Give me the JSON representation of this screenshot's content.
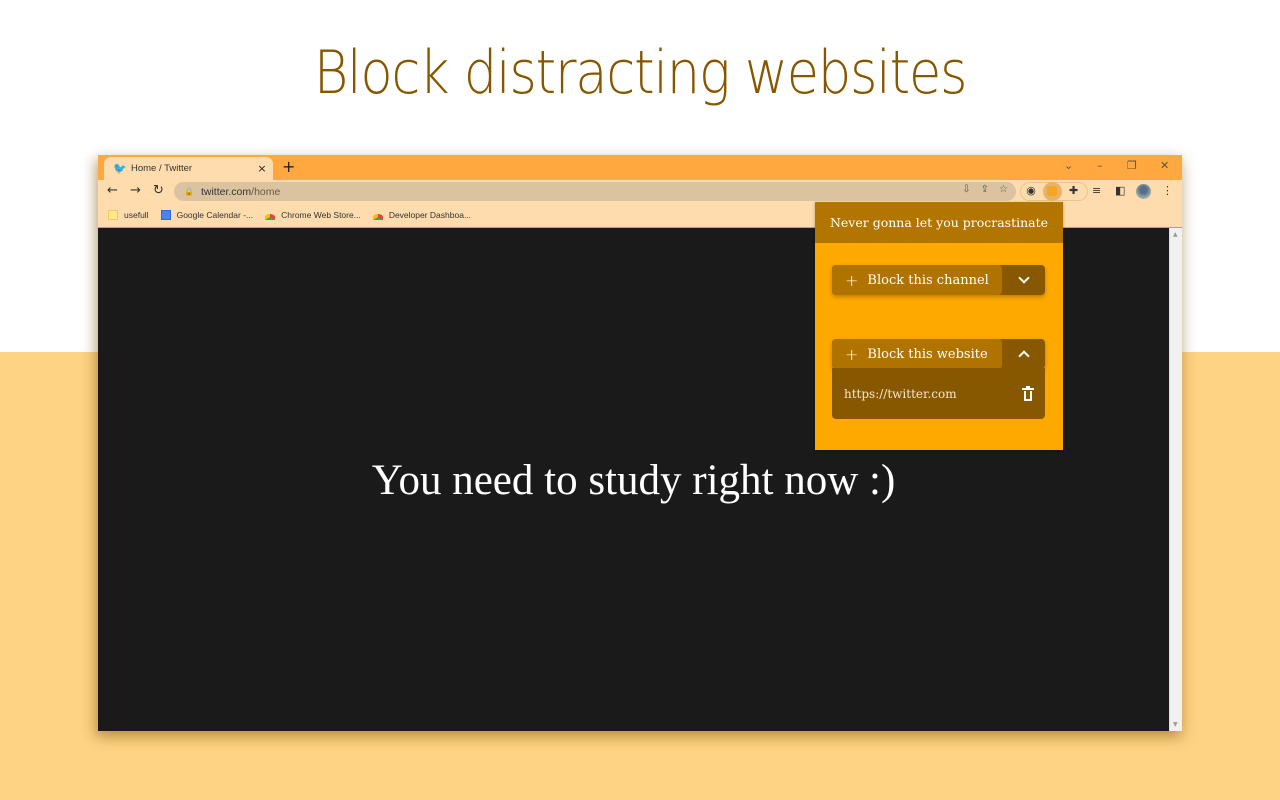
{
  "headline": "Block distracting websites",
  "colors": {
    "headline": "#875700",
    "page_bg_bottom": "#fed383",
    "tabstrip": "#fea83f",
    "toolbar": "#fedcad",
    "popup_bg": "#fea900",
    "popup_header": "#b27500",
    "button_dark": "#875800",
    "button_main": "#b07300",
    "viewport_bg": "#1a1a1a"
  },
  "browser": {
    "tab": {
      "icon": "twitter-bird-icon",
      "title": "Home / Twitter",
      "close": "×"
    },
    "new_tab": "+",
    "window_controls": {
      "tab_search": "⌄",
      "minimize": "–",
      "restore": "❐",
      "close": "✕"
    },
    "nav": {
      "back": "←",
      "forward": "→",
      "reload": "↻"
    },
    "address": {
      "host": "twitter.com",
      "path": "/home"
    },
    "omnibox_icons": [
      "install-icon",
      "share-icon",
      "star-icon"
    ],
    "toolbar_icons": [
      "extension-icon-1",
      "extension-icon-active",
      "puzzle-icon",
      "reading-list-icon",
      "side-panel-icon",
      "avatar",
      "menu-icon"
    ],
    "bookmarks": [
      {
        "label": "usefull",
        "icon": "folder-icon"
      },
      {
        "label": "Google Calendar -...",
        "icon": "google-calendar-icon"
      },
      {
        "label": "Chrome Web Store...",
        "icon": "chrome-web-store-icon"
      },
      {
        "label": "Developer Dashboa...",
        "icon": "chrome-web-store-icon"
      }
    ]
  },
  "page": {
    "message": "You need to study right now :)"
  },
  "popup": {
    "title": "Never gonna let you procrastinate",
    "channel_button": {
      "label": "Block this channel",
      "expanded": false
    },
    "website_button": {
      "label": "Block this website",
      "expanded": true
    },
    "blocked_sites": [
      "https://twitter.com"
    ]
  }
}
